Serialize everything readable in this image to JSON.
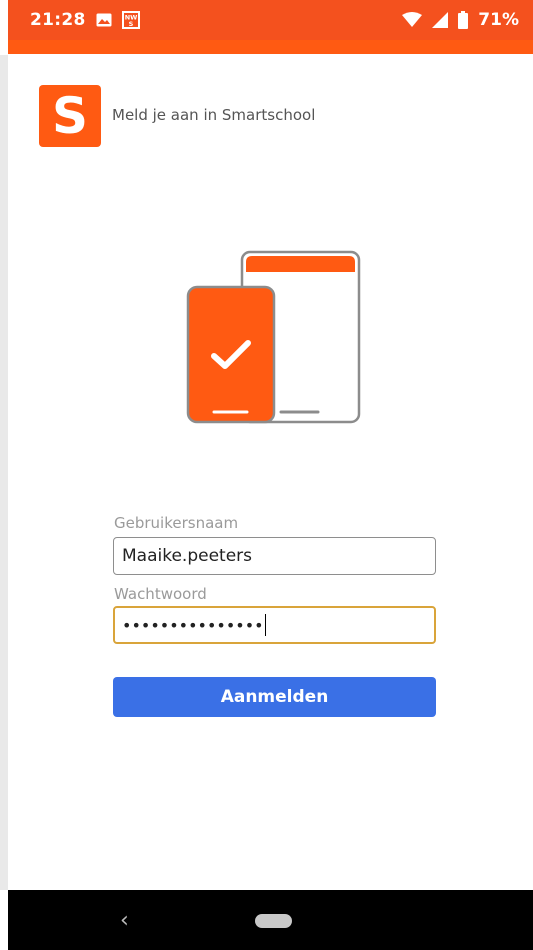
{
  "status_bar": {
    "time": "21:28",
    "notification_icons": [
      "image-icon",
      "nws-icon"
    ],
    "battery_percent": "71%",
    "wifi_icon": "wifi-icon",
    "signal_icon": "cellular-signal-icon",
    "battery_icon": "battery-icon"
  },
  "header": {
    "logo_letter": "S",
    "title": "Meld je aan in Smartschool"
  },
  "illustration": {
    "icon": "phone-tablet-checkmark-illustration",
    "accent_color": "#ff5a12"
  },
  "form": {
    "username_label": "Gebruikersnaam",
    "username_value": "Maaike.peeters",
    "password_label": "Wachtwoord",
    "password_value": "•••••••••••••••",
    "submit_label": "Aanmelden"
  },
  "colors": {
    "status_bar": "#f4511e",
    "brand": "#ff5a12",
    "button": "#3a70e6",
    "focus_border": "#d9a43a"
  },
  "nav_bar": {
    "back_icon": "back-chevron-icon",
    "home_icon": "home-pill-icon"
  }
}
